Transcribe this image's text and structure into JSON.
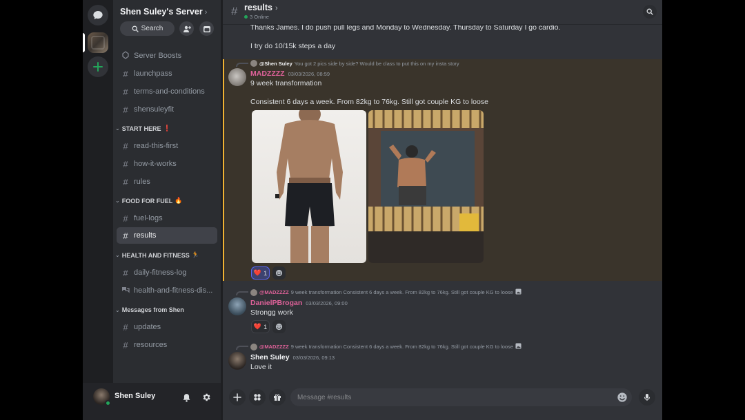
{
  "server": {
    "name": "Shen Suley's Server",
    "search_label": "Search"
  },
  "sidebar": {
    "top_channels": [
      {
        "label": "Server Boosts",
        "icon": "boost-icon"
      },
      {
        "label": "launchpass",
        "icon": "hash-icon"
      },
      {
        "label": "terms-and-conditions",
        "icon": "hash-icon"
      },
      {
        "label": "shensuleyfit",
        "icon": "hash-icon"
      }
    ],
    "categories": [
      {
        "label": "START HERE",
        "emoji": "❗",
        "channels": [
          "read-this-first",
          "how-it-works",
          "rules"
        ]
      },
      {
        "label": "FOOD FOR FUEL",
        "emoji": "🔥",
        "channels": [
          "fuel-logs",
          "results"
        ]
      },
      {
        "label": "HEALTH AND FITNESS",
        "emoji": "🏃",
        "channels": [
          "daily-fitness-log",
          "health-and-fitness-dis..."
        ]
      },
      {
        "label": "Messages from Shen",
        "emoji": "",
        "channels": [
          "updates",
          "resources"
        ]
      }
    ],
    "active_channel": "results"
  },
  "user_panel": {
    "name": "Shen Suley",
    "status": "online"
  },
  "channel_header": {
    "name": "results",
    "online": "3 Online"
  },
  "messages": {
    "m0": {
      "line1": "Thanks James. I do push pull legs and Monday to Wednesday. Thursday to Saturday I go cardio.",
      "line2": "I try do 10/15k steps a day"
    },
    "m1": {
      "reply_name": "@Shen Suley",
      "reply_text": "You got 2 pics side by side? Would be class to put this on my insta story",
      "author": "MADZZZZ",
      "timestamp": "03/03/2026, 08:59",
      "line1": "9 week transformation",
      "line2": "Consistent 6 days a week. From 82kg to 76kg. Still got couple KG to loose",
      "reaction_emoji": "❤️",
      "reaction_count": "1"
    },
    "m2": {
      "reply_name": "@MADZZZZ",
      "reply_text": "9 week transformation  Consistent 6 days a week. From 82kg to 76kg. Still got couple KG to loose",
      "author": "DanielPBrogan",
      "timestamp": "03/03/2026, 09:00",
      "line1": "Strongg work",
      "reaction_emoji": "❤️",
      "reaction_count": "1"
    },
    "m3": {
      "reply_name": "@MADZZZZ",
      "reply_text": "9 week transformation  Consistent 6 days a week. From 82kg to 76kg. Still got couple KG to loose",
      "author": "Shen Suley",
      "timestamp": "03/03/2026, 09:13",
      "line1": "Love it"
    }
  },
  "composer": {
    "placeholder": "Message #results"
  },
  "colors": {
    "accent": "#5865f2",
    "online": "#23a55a",
    "mention_bg": "#3a342b",
    "mention_bar": "#f0b232",
    "madzzzz": "#e0629a",
    "daniel": "#e0629a"
  }
}
